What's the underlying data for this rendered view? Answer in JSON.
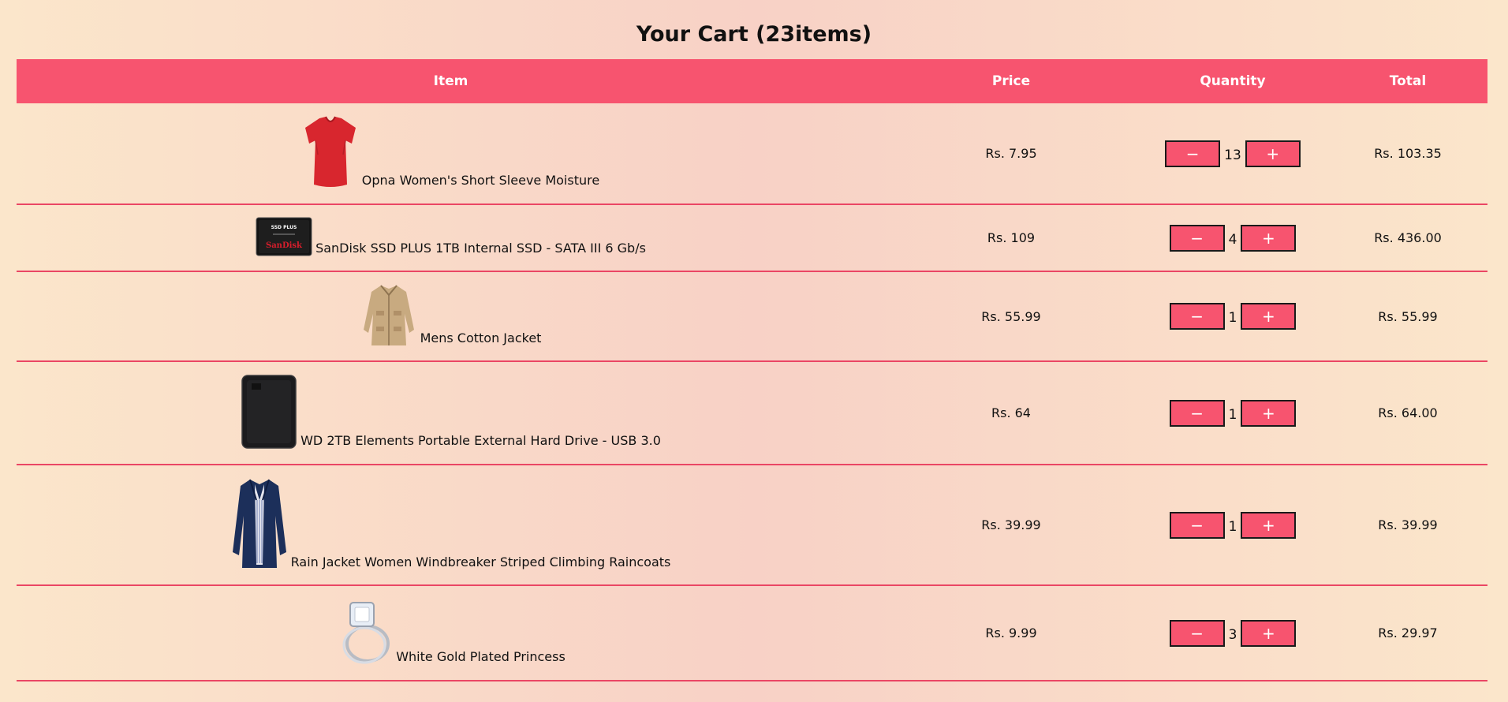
{
  "cart": {
    "title": "Your Cart (23items)",
    "headers": {
      "item": "Item",
      "price": "Price",
      "quantity": "Quantity",
      "total": "Total"
    },
    "decrement_label": "−",
    "increment_label": "+",
    "items": [
      {
        "name": "Opna Women's Short Sleeve Moisture",
        "price": "Rs. 7.95",
        "quantity": "13",
        "total": "Rs. 103.35",
        "icon": "red-tshirt-image"
      },
      {
        "name": "SanDisk SSD PLUS 1TB Internal SSD - SATA III 6 Gb/s",
        "price": "Rs. 109",
        "quantity": "4",
        "total": "Rs. 436.00",
        "icon": "ssd-image",
        "image_text": {
          "brand": "SanDisk",
          "model": "SSD PLUS"
        }
      },
      {
        "name": "Mens Cotton Jacket",
        "price": "Rs. 55.99",
        "quantity": "1",
        "total": "Rs. 55.99",
        "icon": "beige-jacket-image"
      },
      {
        "name": "WD 2TB Elements Portable External Hard Drive - USB 3.0",
        "price": "Rs. 64",
        "quantity": "1",
        "total": "Rs. 64.00",
        "icon": "hard-drive-image"
      },
      {
        "name": "Rain Jacket Women Windbreaker Striped Climbing Raincoats",
        "price": "Rs. 39.99",
        "quantity": "1",
        "total": "Rs. 39.99",
        "icon": "navy-raincoat-image"
      },
      {
        "name": "White Gold Plated Princess",
        "price": "Rs. 9.99",
        "quantity": "3",
        "total": "Rs. 29.97",
        "icon": "ring-image"
      }
    ]
  },
  "colors": {
    "accent": "#f7546f",
    "row_divider": "#ea4664",
    "background_edge": "#fbe6cb",
    "background_center": "#f8d1c6"
  }
}
